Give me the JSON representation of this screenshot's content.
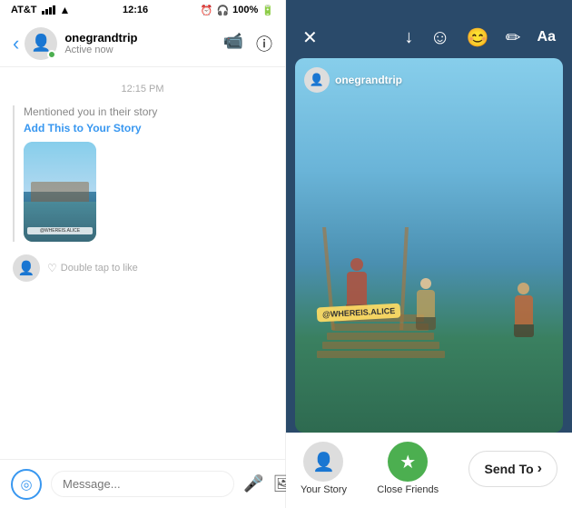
{
  "left": {
    "status_bar": {
      "carrier": "AT&T",
      "time": "12:16",
      "battery": "100%"
    },
    "header": {
      "username": "onegrandtrip",
      "active_status": "Active now",
      "back_icon": "‹",
      "video_icon": "□",
      "info_icon": "ⓘ"
    },
    "chat": {
      "timestamp": "12:15 PM",
      "mention_text": "Mentioned you in their story",
      "add_link": "Add This to Your Story",
      "double_tap": "Double tap to like"
    },
    "input": {
      "placeholder": "Message...",
      "camera_icon": "◎",
      "mic_icon": "🎤",
      "gallery_icon": "⊞",
      "plus_icon": "⊕"
    }
  },
  "right": {
    "top_bar": {
      "close_icon": "✕",
      "download_icon": "↓",
      "emoji_add_icon": "☺",
      "sticker_icon": "◉",
      "draw_icon": "✏",
      "text_icon": "Aa"
    },
    "story": {
      "username": "onegrandtrip",
      "mention_label": "@WHEREIS.ALICE"
    },
    "bottom": {
      "your_story_label": "Your Story",
      "close_friends_label": "Close Friends",
      "send_to_label": "Send To",
      "chevron": "›"
    }
  }
}
